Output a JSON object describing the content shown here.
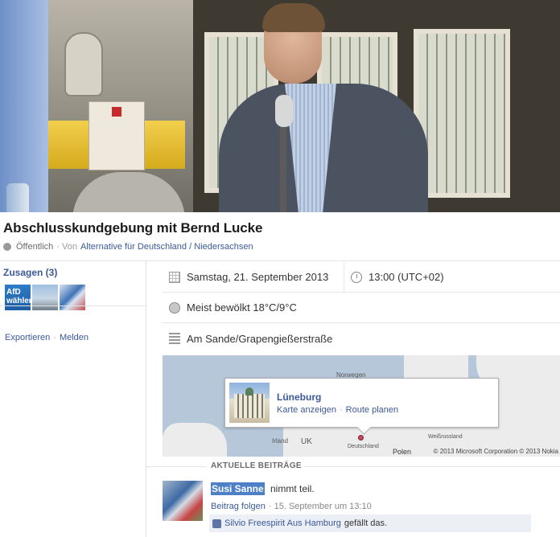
{
  "event": {
    "title": "Abschlusskundgebung mit Bernd Lucke",
    "privacy": "Öffentlich",
    "by_prefix": "· Von",
    "organizer": "Alternative für Deutschland / Niedersachsen"
  },
  "sidebar": {
    "rsvp_label": "Zusagen (3)",
    "thumb1_text": "AfD wählen",
    "export_label": "Exportieren",
    "report_label": "Melden"
  },
  "details": {
    "date": "Samstag, 21. September 2013",
    "time": "13:00 (UTC+02)",
    "weather": "Meist bewölkt 18°C/9°C",
    "location": "Am Sande/Grapengießerstraße"
  },
  "map": {
    "city": "Lüneburg",
    "show_map": "Karte anzeigen",
    "route": "Route planen",
    "label_uk": "UK",
    "label_ireland": "Irland",
    "label_poland": "Polen",
    "label_germany": "Deutschland",
    "label_norway": "Norwegen",
    "label_belarus": "Weißrussland",
    "copyright": "© 2013 Microsoft Corporation © 2013 Nokia"
  },
  "posts": {
    "heading": "AKTUELLE BEITRÄGE",
    "author": "Susi Sanne",
    "action": "nimmt teil.",
    "follow": "Beitrag folgen",
    "timestamp": "· 15. September um 13:10",
    "liker": "Silvio Freespirit Aus Hamburg",
    "likes_suffix": "gefällt das."
  }
}
